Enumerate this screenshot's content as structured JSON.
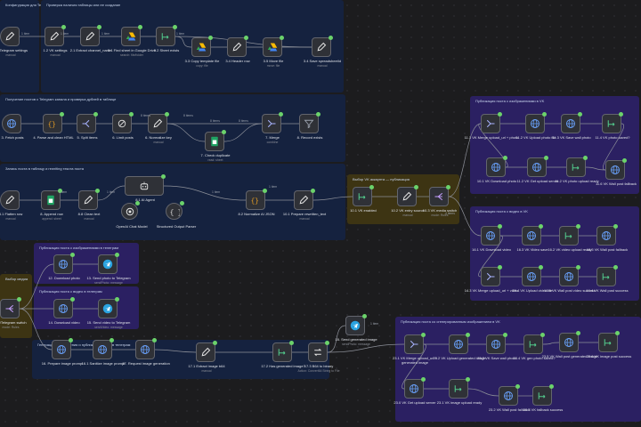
{
  "canvas": {
    "background": "#1c1c1e",
    "wire_color": "#8d9099",
    "success_color": "#6bd36b"
  },
  "stickies": [
    {
      "id": "s1",
      "color": "blue",
      "caption": "Конфигурация для Telegram и VK"
    },
    {
      "id": "s2",
      "color": "blue",
      "caption": "Проверка наличия таблицы или ее создание"
    },
    {
      "id": "s3",
      "color": "blue",
      "caption": "Получение постов с Telegram канала и проверка дублей в таблице"
    },
    {
      "id": "s4",
      "color": "blue",
      "caption": "Запись поста в таблицу и rewriting текста поста"
    },
    {
      "id": "s5",
      "color": "gold",
      "caption": "Выбор VK аккаунта — публикация"
    },
    {
      "id": "s6",
      "color": "purple",
      "caption": "Публикация поста с изображениями в VK"
    },
    {
      "id": "s7",
      "color": "purple",
      "caption": "Публикация поста с видео в VK"
    },
    {
      "id": "s8",
      "color": "purple",
      "caption": "Публикация поста с изображениями в телеграм"
    },
    {
      "id": "s9",
      "color": "purple",
      "caption": "Публикация поста с видео в телеграм"
    },
    {
      "id": "s10",
      "color": "gold",
      "caption": "Выбор медиа"
    },
    {
      "id": "s11",
      "color": "blue",
      "caption": "Генерация изображения и публикация поста в телеграм"
    },
    {
      "id": "s12",
      "color": "purple",
      "caption": "Публикация поста со сгенерированным изображением в VK"
    }
  ],
  "nodes": [
    {
      "label": "1.1 Telegram settings",
      "sub": "manual",
      "icon": "pencil-icon"
    },
    {
      "label": "1.2 VK settings",
      "sub": "manual",
      "icon": "pencil-icon"
    },
    {
      "label": "2.1 Extract channel_name",
      "sub": "",
      "icon": "pencil-icon"
    },
    {
      "label": "3.1 Find sheet in Google Drive",
      "sub": "search: file/folder",
      "icon": "google-drive-icon"
    },
    {
      "label": "3.2 Sheet exists",
      "sub": "",
      "icon": "if-icon"
    },
    {
      "label": "3.3 Copy template file",
      "sub": "copy: file",
      "icon": "google-drive-icon"
    },
    {
      "label": "3.4 Header row",
      "sub": "",
      "icon": "pencil-icon"
    },
    {
      "label": "3.5 Move file",
      "sub": "move: file",
      "icon": "google-drive-icon"
    },
    {
      "label": "3.4 Save spreadsheetId",
      "sub": "manual",
      "icon": "pencil-icon"
    },
    {
      "label": "3. Fetch posts",
      "sub": "",
      "icon": "globe-icon"
    },
    {
      "label": "4. Parse and clean HTML",
      "sub": "",
      "icon": "code-icon"
    },
    {
      "label": "5. Split items",
      "sub": "",
      "icon": "split-icon"
    },
    {
      "label": "6. Limit posts",
      "sub": "",
      "icon": "limit-icon"
    },
    {
      "label": "6. Normalize key",
      "sub": "manual",
      "icon": "pencil-icon"
    },
    {
      "label": "7. Check duplicate",
      "sub": "read: sheet",
      "icon": "sheets-icon"
    },
    {
      "label": "7. Merge",
      "sub": "combine",
      "icon": "merge-icon"
    },
    {
      "label": "8. Record exists",
      "sub": "",
      "icon": "filter-icon"
    },
    {
      "label": "8.1 Flatten row",
      "sub": "manual",
      "icon": "pencil-icon"
    },
    {
      "label": "8. Append row",
      "sub": "append: sheet",
      "icon": "sheets-icon"
    },
    {
      "label": "8.8 Clean text",
      "sub": "manual",
      "icon": "pencil-icon"
    },
    {
      "label": "8.1 AI Agent",
      "sub": "",
      "icon": "robot-icon"
    },
    {
      "label": "OpenAI Chat Model",
      "sub": "",
      "icon": "openai-icon"
    },
    {
      "label": "Structured Output Parser",
      "sub": "",
      "icon": "braces-icon"
    },
    {
      "label": "8.2 Normalize AI JSON",
      "sub": "",
      "icon": "code-icon"
    },
    {
      "label": "10.1 Prepare rewritten_text",
      "sub": "manual",
      "icon": "pencil-icon"
    },
    {
      "label": "10.1 VK enabled",
      "sub": "",
      "icon": "if-icon"
    },
    {
      "label": "10.2 VK entry source",
      "sub": "manual",
      "icon": "pencil-icon"
    },
    {
      "label": "10.3 VK media switch",
      "sub": "mode: Rules",
      "icon": "switch-icon"
    },
    {
      "label": "11.1 VK Merge upload_url + photo",
      "sub": "",
      "icon": "merge-icon"
    },
    {
      "label": "11.2 VK Upload photo file",
      "sub": "",
      "icon": "globe-icon"
    },
    {
      "label": "11.3 VK Save wall photo",
      "sub": "",
      "icon": "globe-icon"
    },
    {
      "label": "11.4 VK photo saved?",
      "sub": "",
      "icon": "if-icon"
    },
    {
      "label": "10.1 VK Download photo",
      "sub": "",
      "icon": "globe-icon"
    },
    {
      "label": "11.2 VK Get upload server",
      "sub": "",
      "icon": "globe-icon"
    },
    {
      "label": "11.2 VK photo upload ready",
      "sub": "",
      "icon": "if-icon"
    },
    {
      "label": "11.6 VK Wall post fallback",
      "sub": "",
      "icon": "globe-icon"
    },
    {
      "label": "16.1 VK Download video",
      "sub": "",
      "icon": "globe-icon"
    },
    {
      "label": "16.3 VK Video save",
      "sub": "",
      "icon": "globe-icon"
    },
    {
      "label": "16.2 VK video upload ready",
      "sub": "",
      "icon": "if-icon"
    },
    {
      "label": "16.5 VK Wall post fallback",
      "sub": "",
      "icon": "globe-icon"
    },
    {
      "label": "14.3 VK Merge upload_url + video",
      "sub": "",
      "icon": "merge-icon"
    },
    {
      "label": "16.4 VK Upload video file",
      "sub": "",
      "icon": "globe-icon"
    },
    {
      "label": "16.4 VK Wall post video success",
      "sub": "",
      "icon": "globe-icon"
    },
    {
      "label": "16.4 VK Wall post success",
      "sub": "",
      "icon": "if-icon"
    },
    {
      "label": "12. Download photo",
      "sub": "",
      "icon": "globe-icon"
    },
    {
      "label": "13. Send photo to Telegram",
      "sub": "sendPhoto: message",
      "icon": "telegram-icon"
    },
    {
      "label": "VK/Telegram switch",
      "sub": "mode: Rules",
      "icon": "switch-icon"
    },
    {
      "label": "14. Download video",
      "sub": "",
      "icon": "globe-icon"
    },
    {
      "label": "15. Send video to Telegram",
      "sub": "sendVideo: message",
      "icon": "telegram-icon"
    },
    {
      "label": "16. Prepare image prompt",
      "sub": "",
      "icon": "globe-icon"
    },
    {
      "label": "16.1 Sanitize image prompt",
      "sub": "",
      "icon": "globe-icon"
    },
    {
      "label": "17. Request image generation",
      "sub": "",
      "icon": "globe-icon"
    },
    {
      "label": "17.1 Extract image b64",
      "sub": "manual",
      "icon": "pencil-icon"
    },
    {
      "label": "17.2 Has generated image?",
      "sub": "",
      "icon": "if-icon"
    },
    {
      "label": "17.3 B64 to binary",
      "sub": "Action: Convert64 String to File",
      "icon": "convert-icon"
    },
    {
      "label": "18. Send generated image",
      "sub": "sendPhoto: message",
      "icon": "telegram-icon"
    },
    {
      "label": "23.1 VK Merge upload_url + generated image",
      "sub": "",
      "icon": "merge-icon"
    },
    {
      "label": "23.2 VK Upload generated image",
      "sub": "",
      "icon": "globe-icon"
    },
    {
      "label": "23.3 VK Save wall photo",
      "sub": "",
      "icon": "globe-icon"
    },
    {
      "label": "23.4 VK gen photo saved?",
      "sub": "",
      "icon": "if-icon"
    },
    {
      "label": "23.5 VK Wall post generated image",
      "sub": "",
      "icon": "globe-icon"
    },
    {
      "label": "23.6 VK image post success",
      "sub": "",
      "icon": "if-icon"
    },
    {
      "label": "23.0 VK Get upload server",
      "sub": "",
      "icon": "globe-icon"
    },
    {
      "label": "23.1 VK image upload ready",
      "sub": "",
      "icon": "if-icon"
    },
    {
      "label": "23.2 VK Wall post fallback",
      "sub": "",
      "icon": "globe-icon"
    },
    {
      "label": "23.3 VK fallback success",
      "sub": "",
      "icon": "if-icon"
    }
  ],
  "edge_labels": [
    {
      "text": "1 item"
    },
    {
      "text": "1 item"
    },
    {
      "text": "1 item"
    },
    {
      "text": "1 item"
    },
    {
      "text": "8 items"
    },
    {
      "text": "8 items"
    },
    {
      "text": "8 items"
    },
    {
      "text": "8 items"
    },
    {
      "text": "1 item"
    },
    {
      "text": "1 item"
    },
    {
      "text": "1 item"
    },
    {
      "text": "1 item"
    },
    {
      "text": "4 items"
    },
    {
      "text": "1 item"
    }
  ]
}
